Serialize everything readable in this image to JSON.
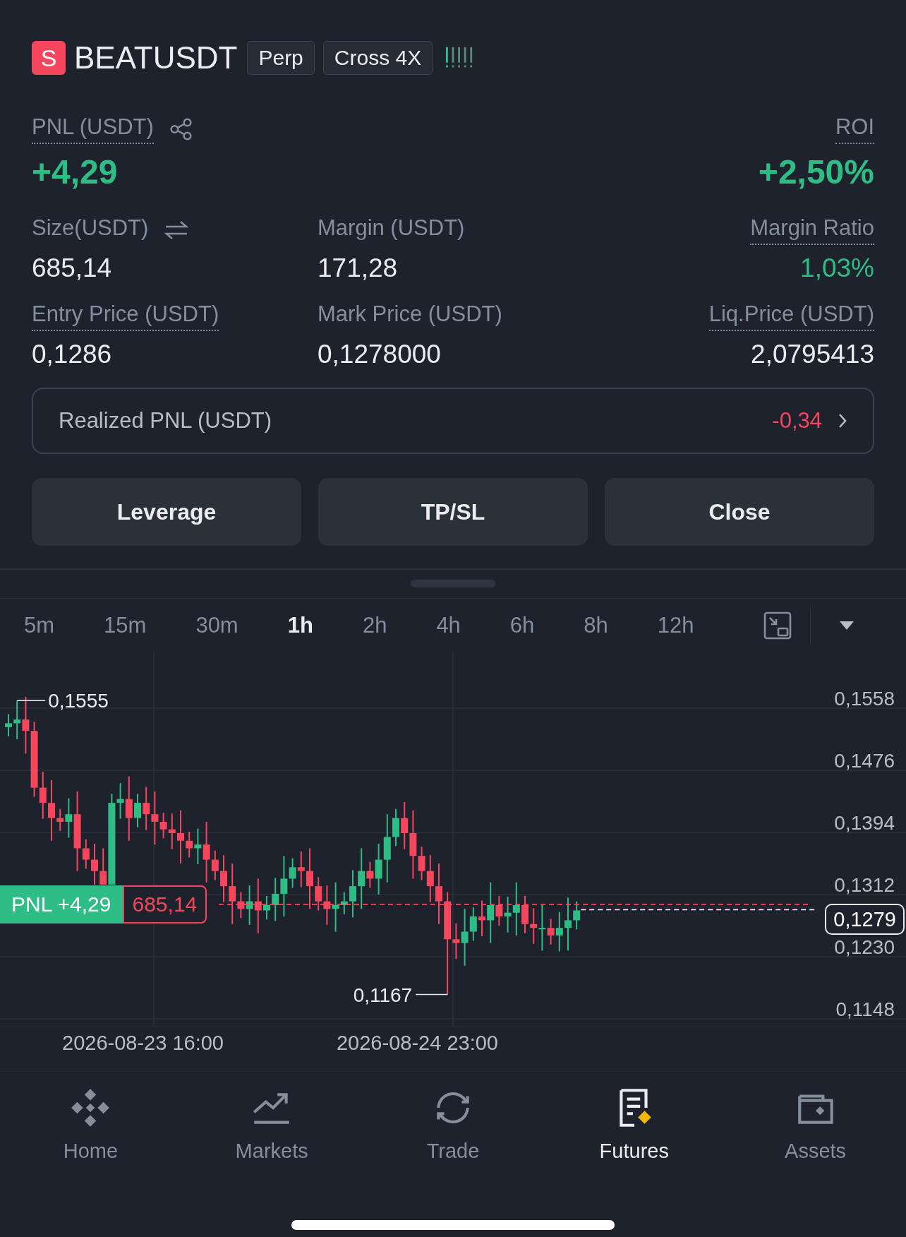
{
  "header": {
    "symbol_badge": "S",
    "symbol": "BEATUSDT",
    "tags": [
      "Perp",
      "Cross 4X"
    ]
  },
  "pnl": {
    "label": "PNL (USDT)",
    "value": "+4,29"
  },
  "roi": {
    "label": "ROI",
    "value": "+2,50%"
  },
  "stats": [
    {
      "label": "Size(USDT)",
      "value": "685,14",
      "underlined": false,
      "positive": false
    },
    {
      "label": "Margin (USDT)",
      "value": "171,28",
      "underlined": false,
      "positive": false
    },
    {
      "label": "Margin Ratio",
      "value": "1,03%",
      "underlined": true,
      "positive": true
    },
    {
      "label": "Entry Price (USDT)",
      "value": "0,1286",
      "underlined": true,
      "positive": false
    },
    {
      "label": "Mark Price (USDT)",
      "value": "0,1278000",
      "underlined": false,
      "positive": false
    },
    {
      "label": "Liq.Price (USDT)",
      "value": "2,0795413",
      "underlined": true,
      "positive": false
    }
  ],
  "realized_pnl": {
    "label": "Realized PNL (USDT)",
    "value": "-0,34"
  },
  "buttons": [
    "Leverage",
    "TP/SL",
    "Close"
  ],
  "timeframes": [
    {
      "label": "5m",
      "selected": false
    },
    {
      "label": "15m",
      "selected": false
    },
    {
      "label": "30m",
      "selected": false
    },
    {
      "label": "1h",
      "selected": true
    },
    {
      "label": "2h",
      "selected": false
    },
    {
      "label": "4h",
      "selected": false
    },
    {
      "label": "6h",
      "selected": false
    },
    {
      "label": "8h",
      "selected": false
    },
    {
      "label": "12h",
      "selected": false
    }
  ],
  "chart": {
    "price_labels": [
      "0,1558",
      "0,1476",
      "0,1394",
      "0,1312",
      "0,1230",
      "0,1148"
    ],
    "high_label": "0,1555",
    "low_label": "0,1167",
    "pnl_tag": "PNL +4,29",
    "size_tag": "685,14",
    "current_price": "0,1279",
    "time_labels": [
      "2026-08-23 16:00",
      "2026-08-24 23:00"
    ]
  },
  "nav": [
    {
      "label": "Home",
      "selected": false
    },
    {
      "label": "Markets",
      "selected": false
    },
    {
      "label": "Trade",
      "selected": false
    },
    {
      "label": "Futures",
      "selected": true
    },
    {
      "label": "Assets",
      "selected": false
    }
  ]
}
